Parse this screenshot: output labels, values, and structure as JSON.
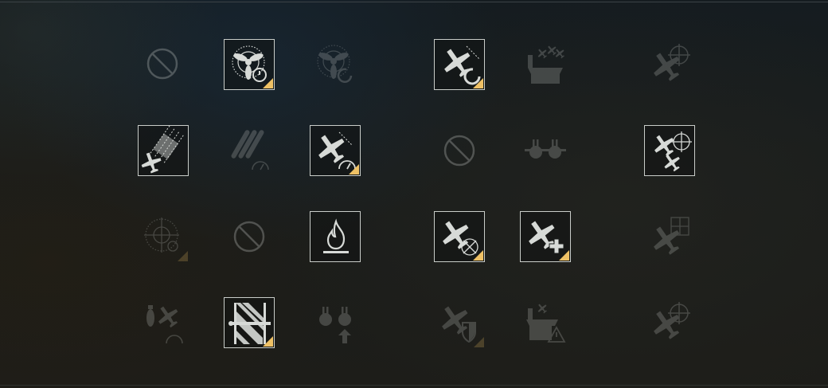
{
  "colors": {
    "frame": "#c9cdc9",
    "icon": "#d7dad7",
    "corner_marker": "#efc165"
  },
  "skills": [
    {
      "id": "r1c1",
      "icon": "slash-circle-icon",
      "state": "blocked",
      "marker": false
    },
    {
      "id": "r1c2",
      "icon": "propeller-timer-icon",
      "state": "learned",
      "marker": true
    },
    {
      "id": "r1c3",
      "icon": "propeller-reload-icon",
      "state": "locked",
      "marker": false
    },
    {
      "id": "r1c5",
      "icon": "plane-reload-icon",
      "state": "learned",
      "marker": true
    },
    {
      "id": "r1c6",
      "icon": "carrier-squadron-icon",
      "state": "locked",
      "marker": false
    },
    {
      "id": "r1c8",
      "icon": "plane-crosshair-icon",
      "state": "locked",
      "marker": false
    },
    {
      "id": "r2c1",
      "icon": "plane-torpedo-spread-icon",
      "state": "learned",
      "marker": false
    },
    {
      "id": "r2c2",
      "icon": "torpedo-speed-icon",
      "state": "locked",
      "marker": false
    },
    {
      "id": "r2c3",
      "icon": "plane-speed-gauge-icon",
      "state": "learned",
      "marker": true
    },
    {
      "id": "r2c5",
      "icon": "slash-circle-icon",
      "state": "blocked",
      "marker": false
    },
    {
      "id": "r2c6",
      "icon": "aa-guns-icon",
      "state": "locked",
      "marker": false
    },
    {
      "id": "r2c8",
      "icon": "double-plane-crosshair-icon",
      "state": "learned",
      "marker": false
    },
    {
      "id": "r3c1",
      "icon": "crosshair-timer-icon",
      "state": "locked",
      "marker": true
    },
    {
      "id": "r3c2",
      "icon": "slash-circle-icon",
      "state": "blocked",
      "marker": false
    },
    {
      "id": "r3c3",
      "icon": "fire-icon",
      "state": "learned",
      "marker": false
    },
    {
      "id": "r3c5",
      "icon": "plane-target-icon",
      "state": "learned",
      "marker": true
    },
    {
      "id": "r3c6",
      "icon": "plane-heal-icon",
      "state": "learned",
      "marker": true
    },
    {
      "id": "r3c8",
      "icon": "plane-grid-icon",
      "state": "locked",
      "marker": false
    },
    {
      "id": "r4c1",
      "icon": "bomb-plane-timer-icon",
      "state": "locked",
      "marker": false
    },
    {
      "id": "r4c2",
      "icon": "armor-belt-icon",
      "state": "learned",
      "marker": true
    },
    {
      "id": "r4c3",
      "icon": "aa-upgrade-icon",
      "state": "locked",
      "marker": false
    },
    {
      "id": "r4c5",
      "icon": "plane-shield-icon",
      "state": "locked",
      "marker": true
    },
    {
      "id": "r4c6",
      "icon": "carrier-warning-icon",
      "state": "locked",
      "marker": false
    },
    {
      "id": "r4c8",
      "icon": "plane-crosshair-icon",
      "state": "locked",
      "marker": false
    }
  ]
}
